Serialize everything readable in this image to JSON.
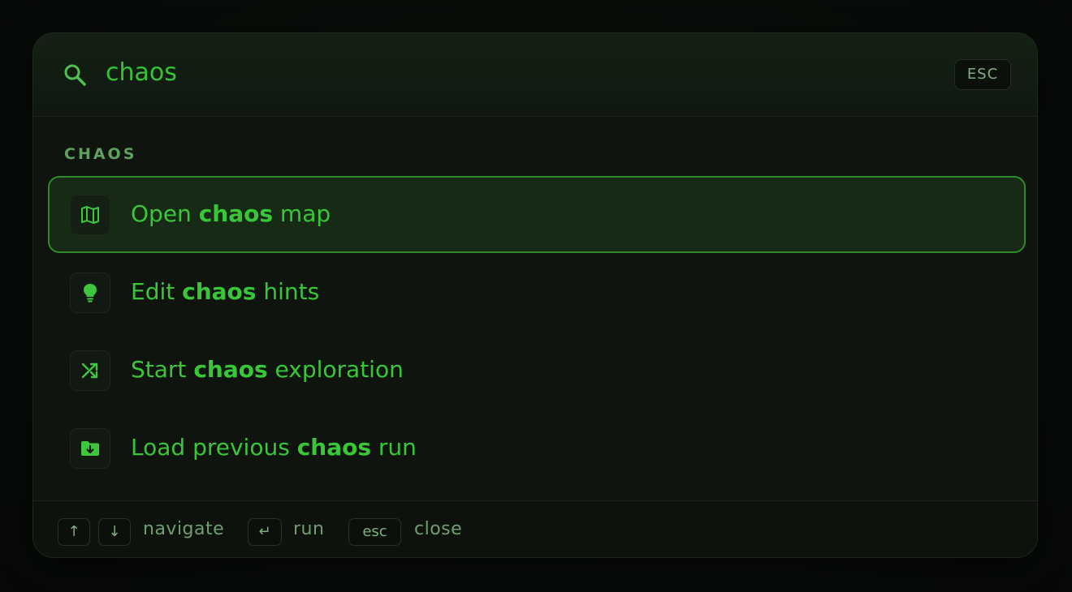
{
  "search": {
    "query": "chaos",
    "esc_label": "ESC",
    "icon": "search-icon"
  },
  "group": {
    "heading": "CHAOS"
  },
  "results": [
    {
      "pre": "Open ",
      "bold": "chaos",
      "post": " map",
      "icon": "map-icon",
      "selected": true
    },
    {
      "pre": "Edit ",
      "bold": "chaos",
      "post": " hints",
      "icon": "lightbulb-icon",
      "selected": false
    },
    {
      "pre": "Start ",
      "bold": "chaos",
      "post": " exploration",
      "icon": "shuffle-icon",
      "selected": false
    },
    {
      "pre": "Load previous ",
      "bold": "chaos",
      "post": " run",
      "icon": "folder-download-icon",
      "selected": false
    }
  ],
  "footer": {
    "up_key": "↑",
    "down_key": "↓",
    "navigate_label": "navigate",
    "enter_key": "↵",
    "run_label": "run",
    "esc_key": "esc",
    "close_label": "close"
  },
  "colors": {
    "accent": "#39c639",
    "selected_bg": "#162a15",
    "selected_border": "#2f8a2b",
    "panel_bg": "#0f140f"
  }
}
